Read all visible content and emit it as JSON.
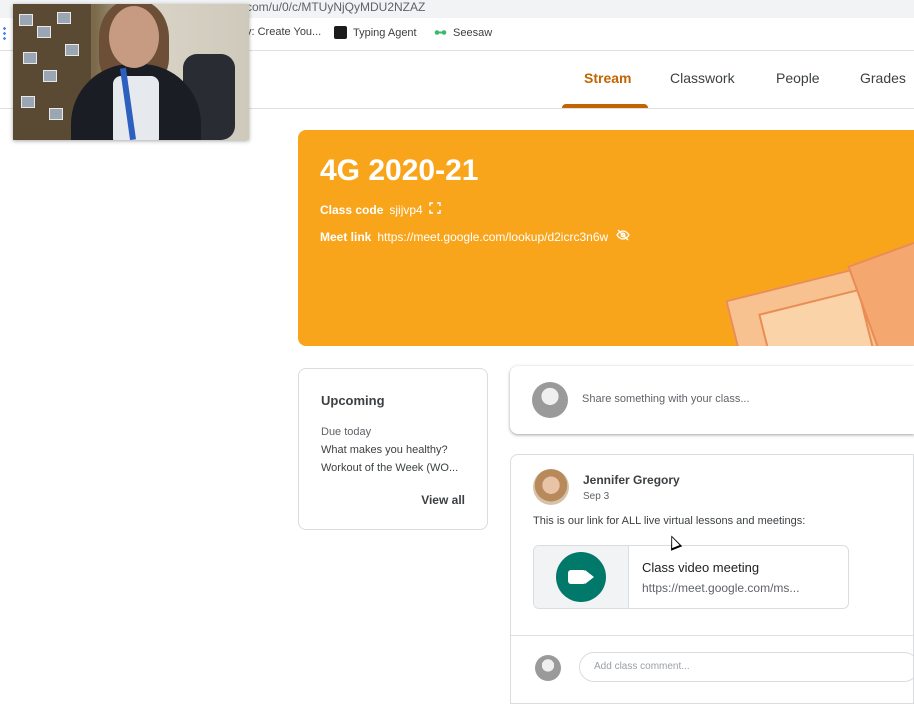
{
  "browser": {
    "url_fragment": "com/u/0/c/MTUyNjQyMDU2NZAZ",
    "bookmarks": [
      {
        "label": "y: Create You...",
        "icon": "bookmark-icon"
      },
      {
        "label": "Typing Agent",
        "icon": "typing-agent-icon"
      },
      {
        "label": "Seesaw",
        "icon": "seesaw-icon"
      }
    ]
  },
  "tabs": [
    {
      "label": "Stream",
      "active": true
    },
    {
      "label": "Classwork",
      "active": false
    },
    {
      "label": "People",
      "active": false
    },
    {
      "label": "Grades",
      "active": false
    }
  ],
  "banner": {
    "title": "4G 2020-21",
    "class_code_label": "Class code",
    "class_code": "sjijvp4",
    "meet_link_label": "Meet link",
    "meet_link": "https://meet.google.com/lookup/d2icrc3n6w",
    "color": "#f9a51b"
  },
  "upcoming": {
    "title": "Upcoming",
    "due_label": "Due today",
    "items": [
      "What makes you healthy?",
      "Workout of the Week (WO..."
    ],
    "view_all": "View all"
  },
  "share": {
    "placeholder": "Share something with your class..."
  },
  "post": {
    "author": "Jennifer Gregory",
    "date": "Sep 3",
    "body": "This is our link for ALL live virtual lessons and meetings:",
    "attachment": {
      "title": "Class video meeting",
      "url": "https://meet.google.com/ms..."
    },
    "comment_placeholder": "Add class comment..."
  },
  "colors": {
    "accent": "#c26401",
    "meet_green": "#00796b"
  }
}
